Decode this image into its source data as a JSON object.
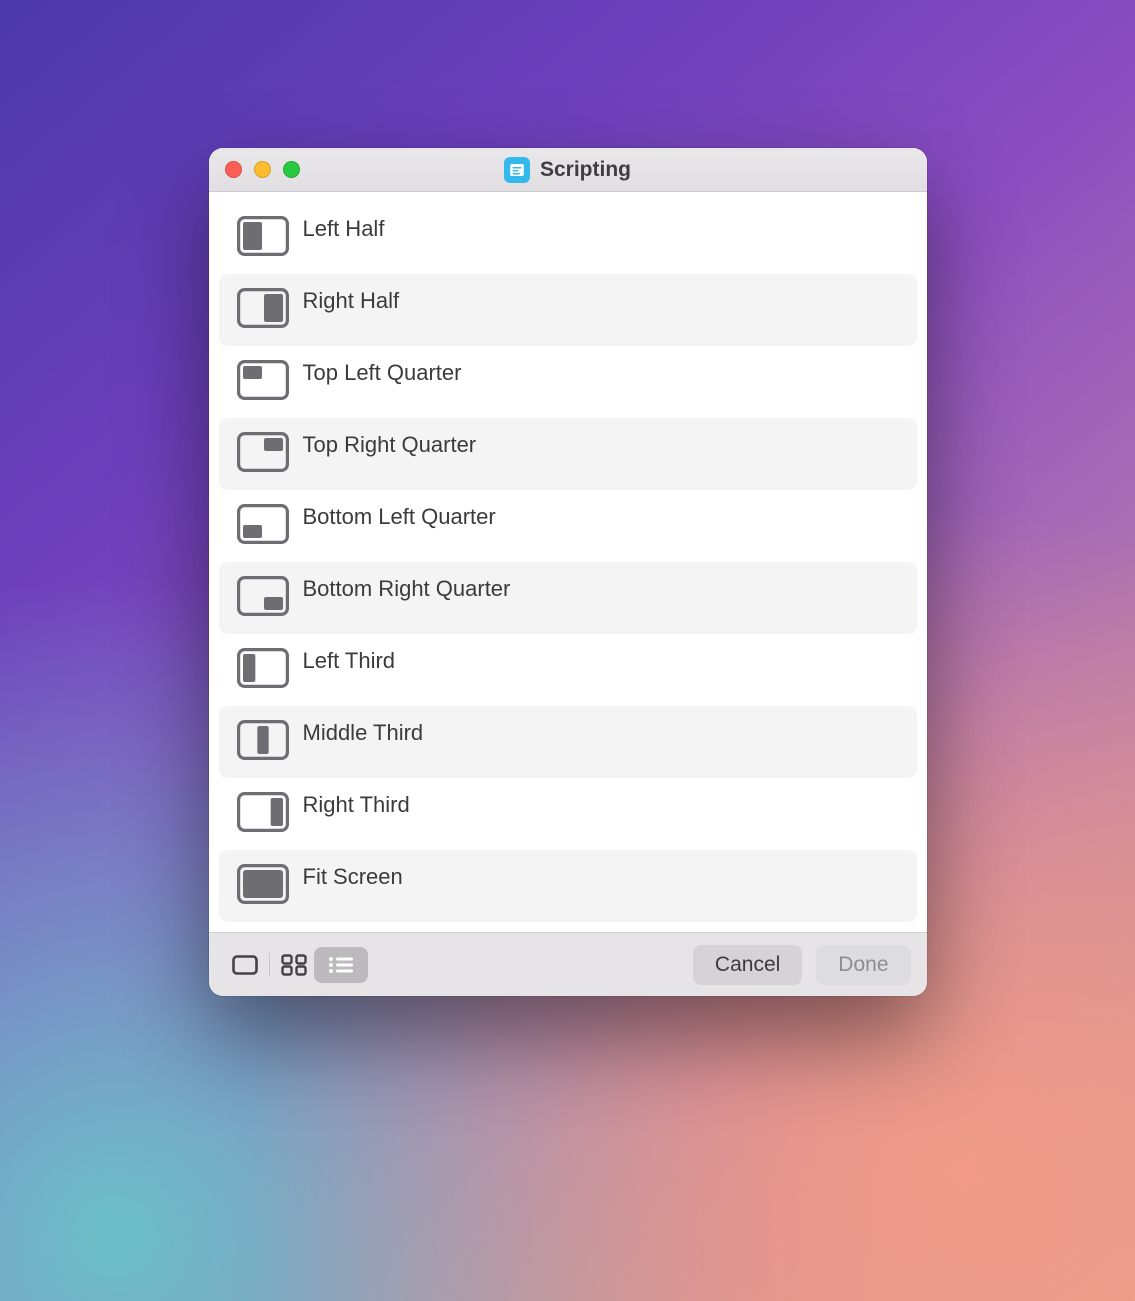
{
  "window": {
    "title": "Scripting"
  },
  "items": [
    {
      "label": "Left Half",
      "icon": "left-half"
    },
    {
      "label": "Right Half",
      "icon": "right-half"
    },
    {
      "label": "Top Left Quarter",
      "icon": "top-left-quarter"
    },
    {
      "label": "Top Right Quarter",
      "icon": "top-right-quarter"
    },
    {
      "label": "Bottom Left Quarter",
      "icon": "bottom-left-quarter"
    },
    {
      "label": "Bottom Right Quarter",
      "icon": "bottom-right-quarter"
    },
    {
      "label": "Left Third",
      "icon": "left-third"
    },
    {
      "label": "Middle Third",
      "icon": "middle-third"
    },
    {
      "label": "Right Third",
      "icon": "right-third"
    },
    {
      "label": "Fit Screen",
      "icon": "fit-screen"
    }
  ],
  "toolbar": {
    "view_mode": "list",
    "cancel_label": "Cancel",
    "done_label": "Done",
    "done_enabled": false
  },
  "colors": {
    "icon_stroke": "#6d6d72",
    "row_alt_bg": "#f4f4f5",
    "title_icon_bg": "#35b9ea"
  }
}
